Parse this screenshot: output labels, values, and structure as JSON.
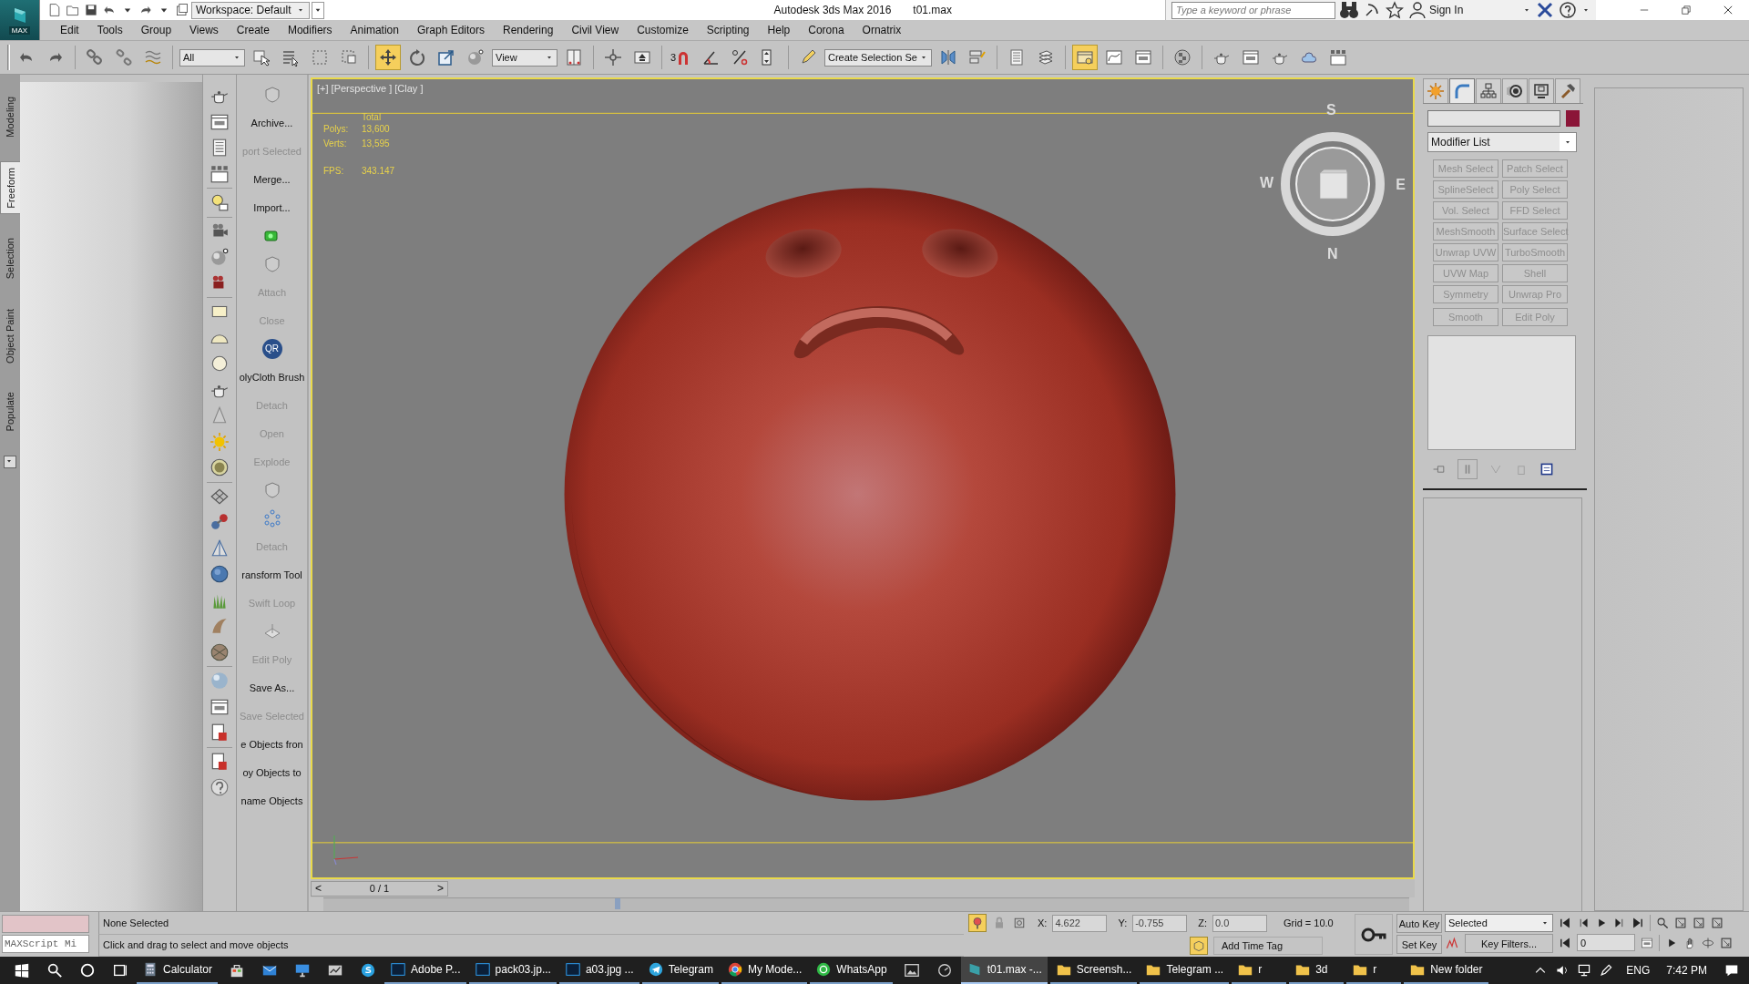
{
  "title_bar": {
    "logo": "MAX",
    "workspace": "Workspace: Default",
    "app_title": "Autodesk 3ds Max 2016",
    "file_name": "t01.max",
    "search": {
      "placeholder": "Type a keyword or phrase"
    },
    "sign_in": "Sign In"
  },
  "menu": [
    "Edit",
    "Tools",
    "Group",
    "Views",
    "Create",
    "Modifiers",
    "Animation",
    "Graph Editors",
    "Rendering",
    "Civil View",
    "Customize",
    "Scripting",
    "Help",
    "Corona",
    "Ornatrix"
  ],
  "toolbar": [
    {
      "kind": "tool",
      "selected": false
    },
    {
      "kind": "tool",
      "selected": false
    },
    {
      "kind": "sep"
    },
    {
      "kind": "tool",
      "selected": false
    },
    {
      "kind": "tool",
      "selected": false
    },
    {
      "kind": "tool",
      "selected": false
    },
    {
      "kind": "sep"
    },
    {
      "kind": "dropdown",
      "value": "All"
    },
    {
      "kind": "tool",
      "selected": false
    },
    {
      "kind": "tool",
      "selected": false
    },
    {
      "kind": "tool",
      "selected": false
    },
    {
      "kind": "tool",
      "selected": false
    },
    {
      "kind": "sep"
    },
    {
      "kind": "tool",
      "selected": true
    },
    {
      "kind": "tool",
      "selected": false
    },
    {
      "kind": "tool",
      "selected": false
    },
    {
      "kind": "tool",
      "selected": false
    },
    {
      "kind": "dropdown",
      "value": "View"
    },
    {
      "kind": "tool",
      "selected": false
    },
    {
      "kind": "sep"
    },
    {
      "kind": "tool",
      "selected": false
    },
    {
      "kind": "tool",
      "selected": false
    },
    {
      "kind": "sep"
    },
    {
      "kind": "snap",
      "label": "3",
      "selected": false
    },
    {
      "kind": "tool",
      "selected": false
    },
    {
      "kind": "tool",
      "selected": false
    },
    {
      "kind": "tool",
      "selected": false
    },
    {
      "kind": "sep"
    },
    {
      "kind": "tool",
      "selected": false
    },
    {
      "kind": "dropdown",
      "value": "Create Selection Se"
    },
    {
      "kind": "tool",
      "selected": false
    },
    {
      "kind": "tool",
      "selected": false
    },
    {
      "kind": "sep"
    },
    {
      "kind": "tool",
      "selected": false
    },
    {
      "kind": "tool",
      "selected": false
    },
    {
      "kind": "sep"
    },
    {
      "kind": "tool",
      "selected": true
    },
    {
      "kind": "tool",
      "selected": false
    },
    {
      "kind": "tool",
      "selected": false
    },
    {
      "kind": "sep"
    },
    {
      "kind": "tool",
      "selected": false
    },
    {
      "kind": "sep"
    },
    {
      "kind": "tool",
      "selected": false
    },
    {
      "kind": "tool",
      "selected": false
    },
    {
      "kind": "tool",
      "selected": false
    },
    {
      "kind": "tool",
      "selected": false
    },
    {
      "kind": "tool",
      "selected": false
    }
  ],
  "ribbon_tabs": [
    {
      "label": "Modeling",
      "selected": false
    },
    {
      "label": "Freeform",
      "selected": true
    },
    {
      "label": "Selection",
      "selected": false
    },
    {
      "label": "Object Paint",
      "selected": false
    },
    {
      "label": "Populate",
      "selected": false
    }
  ],
  "command_panel": [
    {
      "kind": "icon"
    },
    {
      "kind": "text",
      "label": "Archive...",
      "disabled": false
    },
    {
      "kind": "text",
      "label": "port Selected",
      "disabled": true
    },
    {
      "kind": "text",
      "label": "Merge...",
      "disabled": false
    },
    {
      "kind": "text",
      "label": "Import...",
      "disabled": false
    },
    {
      "kind": "icon"
    },
    {
      "kind": "icon"
    },
    {
      "kind": "text",
      "label": "Attach",
      "disabled": true
    },
    {
      "kind": "text",
      "label": "Close",
      "disabled": true
    },
    {
      "kind": "badge",
      "label": "QR"
    },
    {
      "kind": "text",
      "label": "olyCloth Brush",
      "disabled": false
    },
    {
      "kind": "text",
      "label": "Detach",
      "disabled": true
    },
    {
      "kind": "text",
      "label": "Open",
      "disabled": true
    },
    {
      "kind": "text",
      "label": "Explode",
      "disabled": true
    },
    {
      "kind": "icon"
    },
    {
      "kind": "icon"
    },
    {
      "kind": "text",
      "label": "Detach",
      "disabled": true
    },
    {
      "kind": "text",
      "label": "ransform Tool",
      "disabled": false
    },
    {
      "kind": "text",
      "label": "Swift Loop",
      "disabled": true
    },
    {
      "kind": "icon"
    },
    {
      "kind": "text",
      "label": "Edit Poly",
      "disabled": true
    },
    {
      "kind": "text",
      "label": "Save As...",
      "disabled": false
    },
    {
      "kind": "text",
      "label": "Save Selected",
      "disabled": true
    },
    {
      "kind": "text",
      "label": "e Objects fron",
      "disabled": false
    },
    {
      "kind": "text",
      "label": "oy Objects to",
      "disabled": false
    },
    {
      "kind": "text",
      "label": "name Objects",
      "disabled": false
    }
  ],
  "viewport": {
    "label": "[+] [Perspective ] [Clay ]",
    "stats": {
      "heading": "Total",
      "rows": [
        {
          "label": "Polys:",
          "value": "13,600"
        },
        {
          "label": "Verts:",
          "value": "13,595"
        }
      ],
      "fps_label": "FPS:",
      "fps": "343.147"
    },
    "compass": [
      "S",
      "W",
      "E",
      "N"
    ],
    "time_slider": {
      "prev": "<",
      "position": "0 / 1",
      "next": ">",
      "level": 0
    }
  },
  "modify_panel": {
    "tabs": [
      {
        "selected": false
      },
      {
        "selected": true
      },
      {
        "selected": false
      },
      {
        "selected": false
      },
      {
        "selected": false
      },
      {
        "selected": false
      }
    ],
    "color": "#8b1538",
    "modifier_list": "Modifier List",
    "buttons": [
      {
        "label": "Mesh Select",
        "disabled": true
      },
      {
        "label": "Patch Select",
        "disabled": true
      },
      {
        "label": "SplineSelect",
        "disabled": true
      },
      {
        "label": "Poly Select",
        "disabled": true
      },
      {
        "label": "Vol. Select",
        "disabled": true
      },
      {
        "label": "FFD Select",
        "disabled": true
      },
      {
        "label": "MeshSmooth",
        "disabled": true
      },
      {
        "label": "Surface Select",
        "disabled": true
      },
      {
        "label": "Unwrap UVW",
        "disabled": true
      },
      {
        "label": "TurboSmooth",
        "disabled": true
      },
      {
        "label": "UVW Map",
        "disabled": true
      },
      {
        "label": "Shell",
        "disabled": true
      },
      {
        "label": "Symmetry",
        "disabled": true
      },
      {
        "label": "Unwrap Pro",
        "disabled": true
      },
      {
        "label": "Smooth",
        "disabled": true
      },
      {
        "label": "Edit Poly",
        "disabled": true
      }
    ]
  },
  "status_bar": {
    "listener": "MAXScript Mi",
    "selection": "None Selected",
    "prompt": "Click and drag to select and move objects",
    "coords": [
      {
        "label": "X:",
        "value": "4.622"
      },
      {
        "label": "Y:",
        "value": "-0.755"
      },
      {
        "label": "Z:",
        "value": "0.0"
      }
    ],
    "grid": "Grid = 10.0",
    "time_tag": "Add Time Tag",
    "auto_key": "Auto Key",
    "set_key": "Set Key",
    "key_mode": "Selected",
    "key_filters": "Key Filters...",
    "frame": "0"
  },
  "taskbar": {
    "items": [
      {
        "kind": "app",
        "label": "Calculator",
        "active": false
      },
      {
        "kind": "pinned"
      },
      {
        "kind": "pinned"
      },
      {
        "kind": "pinned"
      },
      {
        "kind": "pinned"
      },
      {
        "kind": "pinned"
      },
      {
        "kind": "app",
        "label": "Adobe P...",
        "active": false
      },
      {
        "kind": "app",
        "label": "pack03.jp...",
        "active": false
      },
      {
        "kind": "app",
        "label": "a03.jpg ...",
        "active": false
      },
      {
        "kind": "app",
        "label": "Telegram",
        "active": false
      },
      {
        "kind": "app",
        "label": "My Mode...",
        "active": false
      },
      {
        "kind": "app",
        "label": "WhatsApp",
        "active": false
      },
      {
        "kind": "pinned"
      },
      {
        "kind": "pinned"
      },
      {
        "kind": "app",
        "label": "t01.max -...",
        "active": true
      },
      {
        "kind": "folder",
        "label": "Screensh...",
        "active": false
      },
      {
        "kind": "folder",
        "label": "Telegram ...",
        "active": false
      },
      {
        "kind": "folder",
        "label": "r",
        "active": false
      },
      {
        "kind": "folder",
        "label": "3d",
        "active": false
      },
      {
        "kind": "folder",
        "label": "r",
        "active": false
      },
      {
        "kind": "folder",
        "label": "New folder",
        "active": false
      }
    ],
    "language": "ENG",
    "time": "7:42 PM"
  }
}
